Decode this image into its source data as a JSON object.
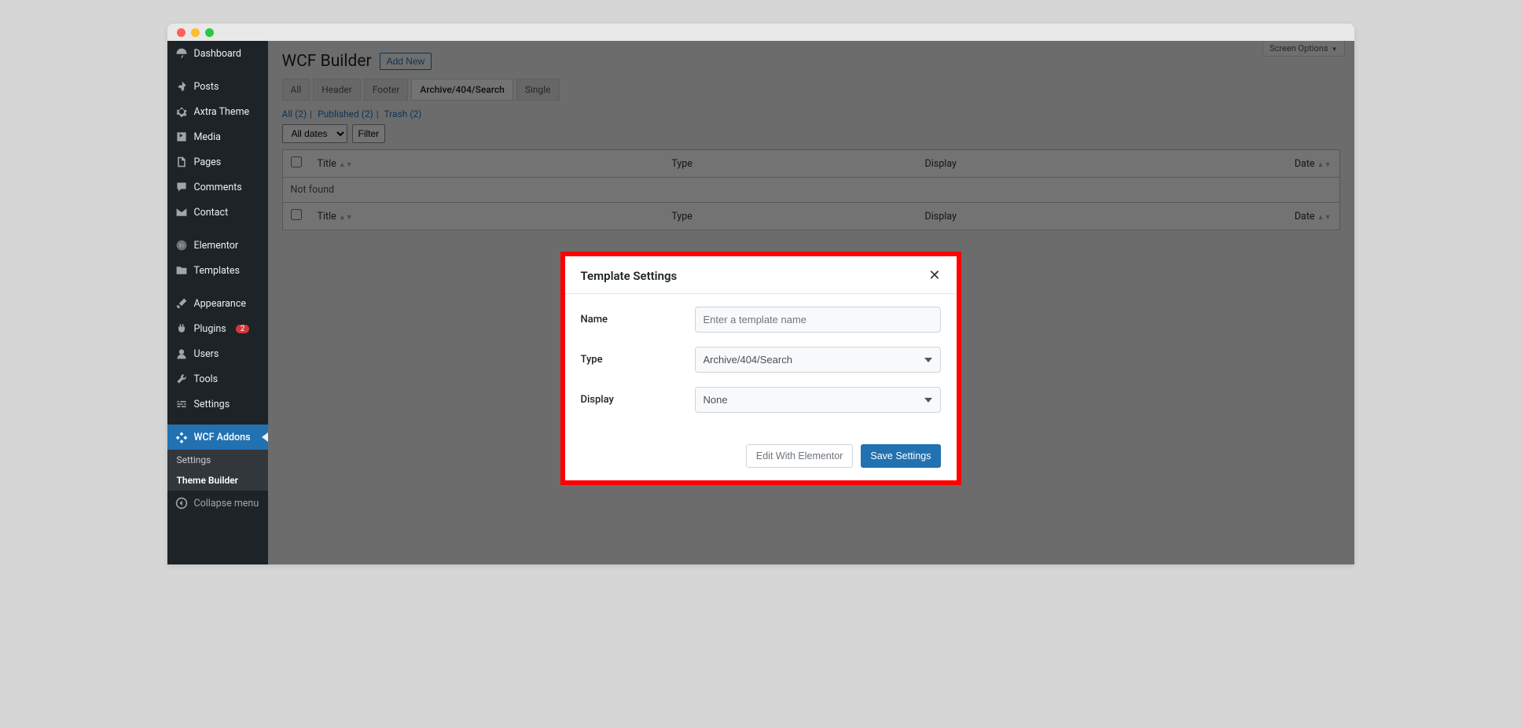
{
  "window": {
    "screen_options": "Screen Options"
  },
  "sidebar": {
    "items": [
      {
        "label": "Dashboard"
      },
      {
        "label": "Posts"
      },
      {
        "label": "Axtra Theme"
      },
      {
        "label": "Media"
      },
      {
        "label": "Pages"
      },
      {
        "label": "Comments"
      },
      {
        "label": "Contact"
      },
      {
        "label": "Elementor"
      },
      {
        "label": "Templates"
      },
      {
        "label": "Appearance"
      },
      {
        "label": "Plugins"
      },
      {
        "label": "Users"
      },
      {
        "label": "Tools"
      },
      {
        "label": "Settings"
      },
      {
        "label": "WCF Addons"
      }
    ],
    "plugins_badge": "2",
    "submenu": [
      {
        "label": "Settings"
      },
      {
        "label": "Theme Builder"
      }
    ],
    "collapse": "Collapse menu"
  },
  "header": {
    "title": "WCF Builder",
    "add_new": "Add New"
  },
  "tabs": [
    {
      "label": "All"
    },
    {
      "label": "Header"
    },
    {
      "label": "Footer"
    },
    {
      "label": "Archive/404/Search"
    },
    {
      "label": "Single"
    }
  ],
  "subsub": {
    "all": "All (2)",
    "published": "Published (2)",
    "trash": "Trash (2)"
  },
  "filters": {
    "dates": "All dates",
    "filter": "Filter"
  },
  "table": {
    "cols": {
      "title": "Title",
      "type": "Type",
      "display": "Display",
      "date": "Date"
    },
    "not_found": "Not found"
  },
  "modal": {
    "title": "Template Settings",
    "labels": {
      "name": "Name",
      "type": "Type",
      "display": "Display"
    },
    "name_placeholder": "Enter a template name",
    "type_value": "Archive/404/Search",
    "display_value": "None",
    "edit_with_elementor": "Edit With Elementor",
    "save": "Save Settings"
  }
}
